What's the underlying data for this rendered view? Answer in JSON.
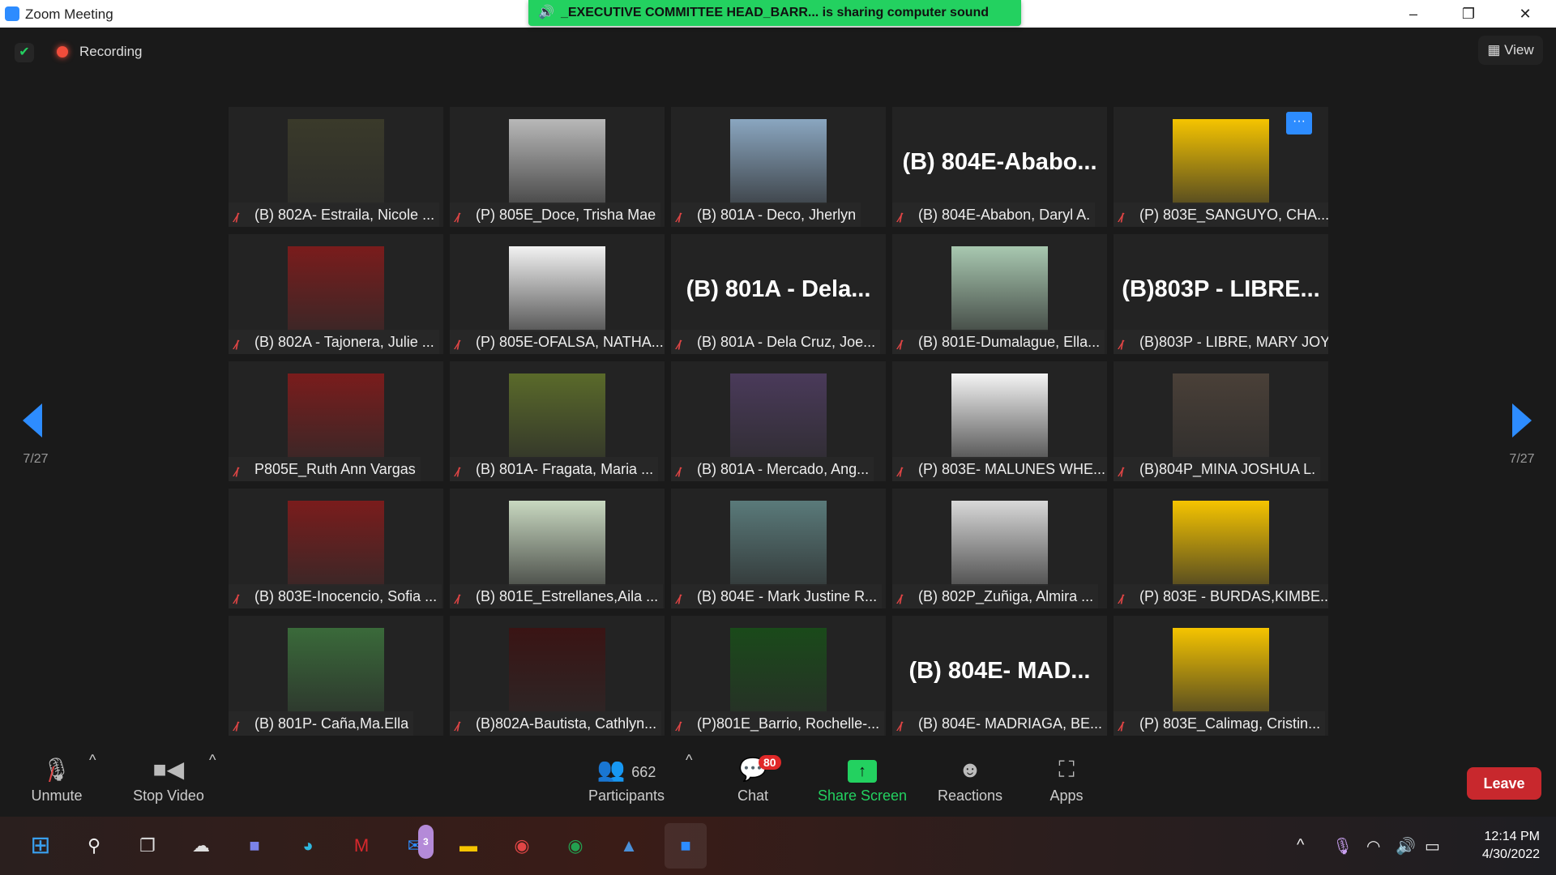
{
  "window": {
    "title": "Zoom Meeting",
    "minimize": "–",
    "restore": "❐",
    "close": "✕"
  },
  "banner": {
    "text": "_EXECUTIVE COMMITTEE HEAD_BARR... is sharing computer sound"
  },
  "topbar": {
    "recording": "Recording",
    "view": "View"
  },
  "pager": {
    "left": "7/27",
    "right": "7/27"
  },
  "tiles": [
    {
      "label": "(B) 802A- Estraila, Nicole ...",
      "video_bg": "#3a3a2a",
      "has_video": true
    },
    {
      "label": "(P) 805E_Doce, Trisha Mae",
      "video_bg": "#b8b8b8",
      "has_video": true
    },
    {
      "label": "(B) 801A - Deco, Jherlyn",
      "video_bg": "#8aa6c0",
      "has_video": true
    },
    {
      "label": "(B) 804E-Ababon, Daryl A.",
      "big": "(B)  804E-Ababo...",
      "has_video": false
    },
    {
      "label": "(P) 803E_SANGUYO, CHA...",
      "video_bg": "#f5c400",
      "has_video": true
    },
    {
      "label": "(B) 802A - Tajonera, Julie ...",
      "video_bg": "#7a1c1c",
      "has_video": true
    },
    {
      "label": "(P) 805E-OFALSA, NATHA...",
      "video_bg": "#f2f2f2",
      "has_video": true
    },
    {
      "label": "(B) 801A - Dela Cruz, Joe...",
      "big": "(B) 801A - Dela...",
      "has_video": false
    },
    {
      "label": "(B) 801E-Dumalague, Ella...",
      "video_bg": "#a8c8b0",
      "has_video": true
    },
    {
      "label": "(B)803P - LIBRE, MARY JOY",
      "big": "(B)803P - LIBRE...",
      "has_video": false
    },
    {
      "label": "P805E_Ruth Ann Vargas",
      "video_bg": "#7a1c1c",
      "has_video": true
    },
    {
      "label": "(B) 801A- Fragata, Maria ...",
      "video_bg": "#5a6a2a",
      "has_video": true
    },
    {
      "label": "(B) 801A - Mercado, Ang...",
      "video_bg": "#4a3a5a",
      "has_video": true
    },
    {
      "label": "(P) 803E- MALUNES WHE...",
      "video_bg": "#f4f4f4",
      "has_video": true
    },
    {
      "label": "(B)804P_MINA JOSHUA L.",
      "video_bg": "#4a4038",
      "has_video": true
    },
    {
      "label": "(B) 803E-Inocencio, Sofia ...",
      "video_bg": "#7a1c1c",
      "has_video": true
    },
    {
      "label": "(B) 801E_Estrellanes,Aila ...",
      "video_bg": "#c8d8c0",
      "has_video": true
    },
    {
      "label": "(B) 804E - Mark Justine R...",
      "video_bg": "#5a7a7a",
      "has_video": true
    },
    {
      "label": "(B) 802P_Zuñiga, Almira ...",
      "video_bg": "#d8d8d8",
      "has_video": true
    },
    {
      "label": "(P) 803E - BURDAS,KIMBE...",
      "video_bg": "#f5c400",
      "has_video": true
    },
    {
      "label": "(B) 801P- Caña,Ma.Ella",
      "video_bg": "#3a6a3a",
      "has_video": true
    },
    {
      "label": "(B)802A-Bautista, Cathlyn...",
      "video_bg": "#3a1414",
      "has_video": true
    },
    {
      "label": "(P)801E_Barrio, Rochelle-...",
      "video_bg": "#1a4a1a",
      "has_video": true
    },
    {
      "label": "(B) 804E- MADRIAGA, BE...",
      "big": "(B)  804E-  MAD...",
      "has_video": false
    },
    {
      "label": "(P) 803E_Calimag, Cristin...",
      "video_bg": "#f5c400",
      "has_video": true
    }
  ],
  "toolbar": {
    "unmute": "Unmute",
    "stop_video": "Stop Video",
    "participants": "Participants",
    "participant_count": "662",
    "chat": "Chat",
    "chat_badge": "80",
    "share": "Share Screen",
    "reactions": "Reactions",
    "apps": "Apps",
    "leave": "Leave"
  },
  "taskbar": {
    "mail_badge": "3",
    "time": "12:14 PM",
    "date": "4/30/2022"
  },
  "colors": {
    "share": "#23d160",
    "leave": "#c8282d",
    "accent": "#2d8cff"
  }
}
